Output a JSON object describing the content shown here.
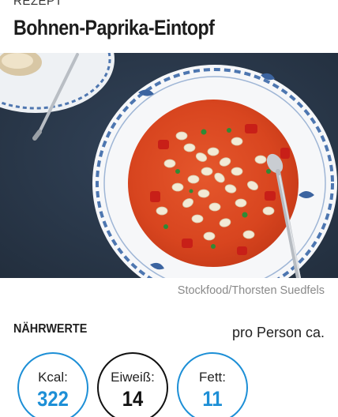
{
  "recipe": {
    "kicker": "REZEPT",
    "title": "Bohnen-Paprika-Eintopf",
    "photo_credit": "Stockfood/Thorsten Suedfels"
  },
  "nutrition": {
    "heading": "NÄHRWERTE",
    "per_label": "pro Person ca.",
    "items": [
      {
        "label": "Kcal:",
        "value": "322",
        "color": "#1d8fd6"
      },
      {
        "label": "Eiweiß:",
        "value": "14",
        "color": "#111111"
      },
      {
        "label": "Fett:",
        "value": "11",
        "color": "#1d8fd6"
      }
    ]
  },
  "colors": {
    "accent": "#1d8fd6",
    "tablecloth": "#2c3a4c",
    "text": "#1c1c1c",
    "muted": "#8a8a8a"
  }
}
